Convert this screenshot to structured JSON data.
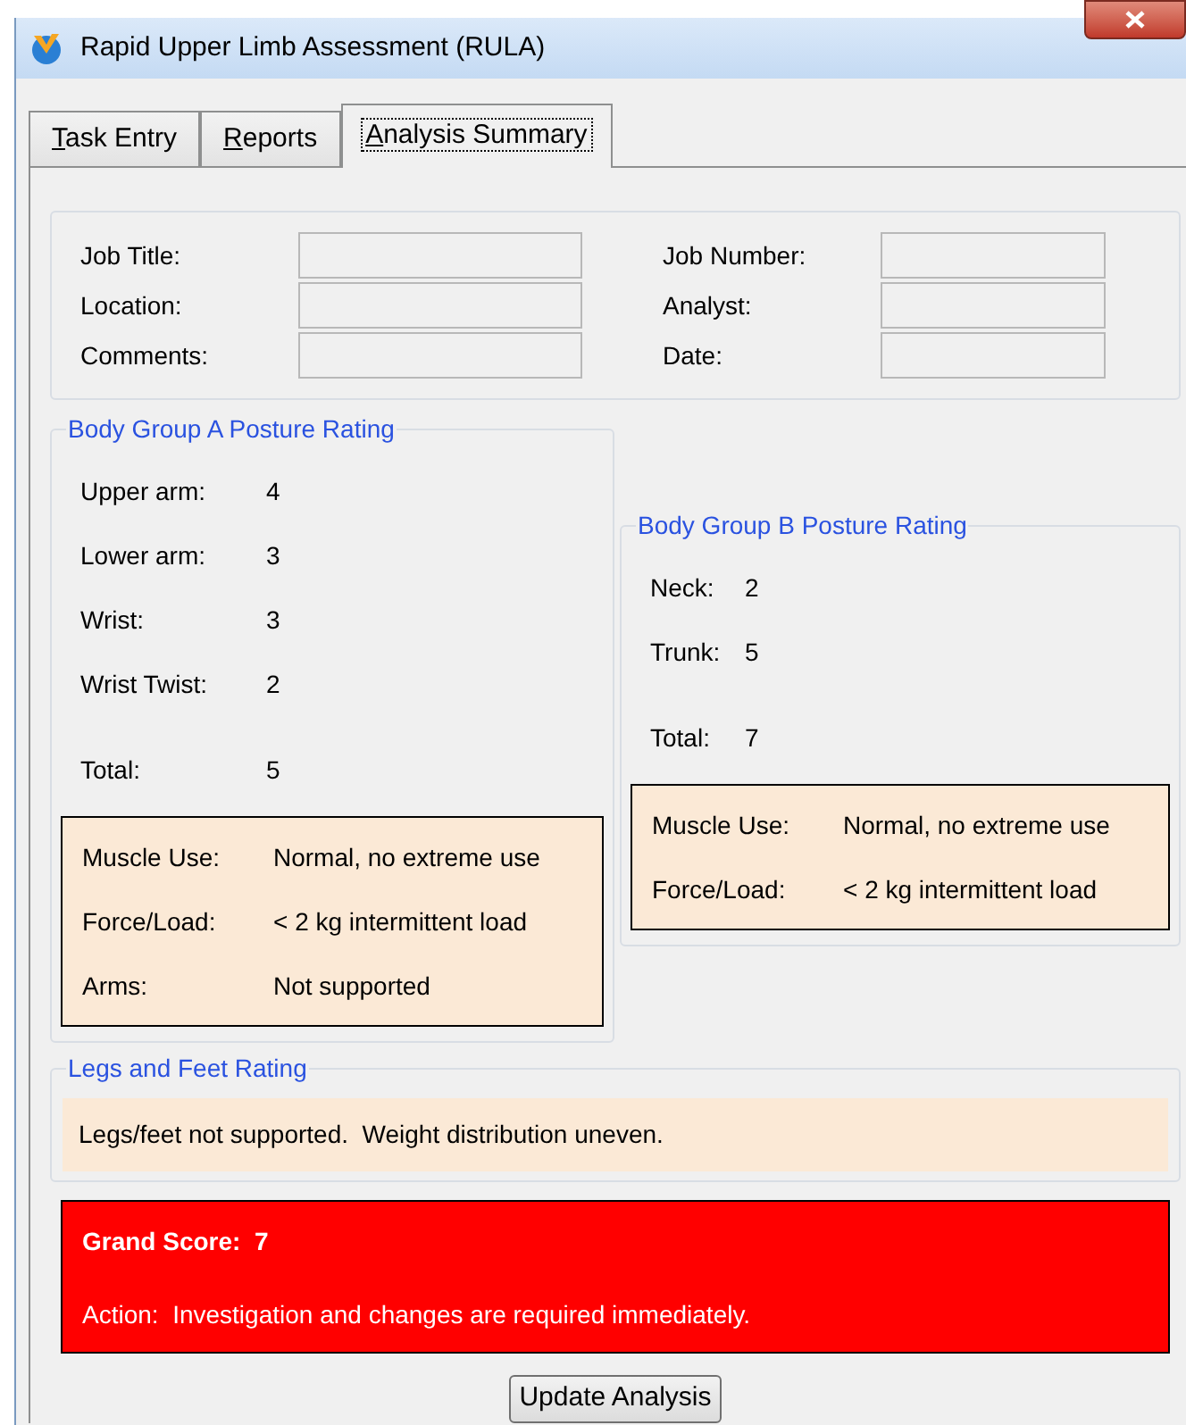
{
  "window": {
    "title": "Rapid Upper Limb Assessment (RULA)"
  },
  "tabs": [
    {
      "label": "Task Entry",
      "selected": false
    },
    {
      "label": "Reports",
      "selected": false
    },
    {
      "label": "Analysis Summary",
      "selected": true
    }
  ],
  "job_info": {
    "left": [
      {
        "label": "Job Title:"
      },
      {
        "label": "Location:"
      },
      {
        "label": "Comments:"
      }
    ],
    "right": [
      {
        "label": "Job Number:"
      },
      {
        "label": "Analyst:"
      },
      {
        "label": "Date:"
      }
    ]
  },
  "group_a": {
    "title": "Body Group A Posture Rating",
    "scores": [
      {
        "label": "Upper arm:",
        "value": "4"
      },
      {
        "label": "Lower arm:",
        "value": "3"
      },
      {
        "label": "Wrist:",
        "value": "3"
      },
      {
        "label": "Wrist Twist:",
        "value": "2"
      }
    ],
    "total": {
      "label": "Total:",
      "value": "5"
    },
    "factors": [
      {
        "label": "Muscle Use:",
        "value": "Normal, no extreme use"
      },
      {
        "label": "Force/Load:",
        "value": "< 2 kg intermittent load"
      },
      {
        "label": "Arms:",
        "value": "Not supported"
      }
    ]
  },
  "group_b": {
    "title": "Body Group B Posture Rating",
    "scores": [
      {
        "label": "Neck:",
        "value": "2"
      },
      {
        "label": "Trunk:",
        "value": "5"
      }
    ],
    "total": {
      "label": "Total:",
      "value": "7"
    },
    "factors": [
      {
        "label": "Muscle Use:",
        "value": "Normal, no extreme use"
      },
      {
        "label": "Force/Load:",
        "value": "< 2 kg intermittent load"
      }
    ]
  },
  "legs": {
    "title": "Legs and Feet Rating",
    "text": "Legs/feet not supported.  Weight distribution uneven."
  },
  "result": {
    "score": "Grand Score:  7",
    "action": "Action:  Investigation and changes are required immediately.",
    "color": "#ff0000"
  },
  "buttons": [
    "Update Analysis"
  ]
}
